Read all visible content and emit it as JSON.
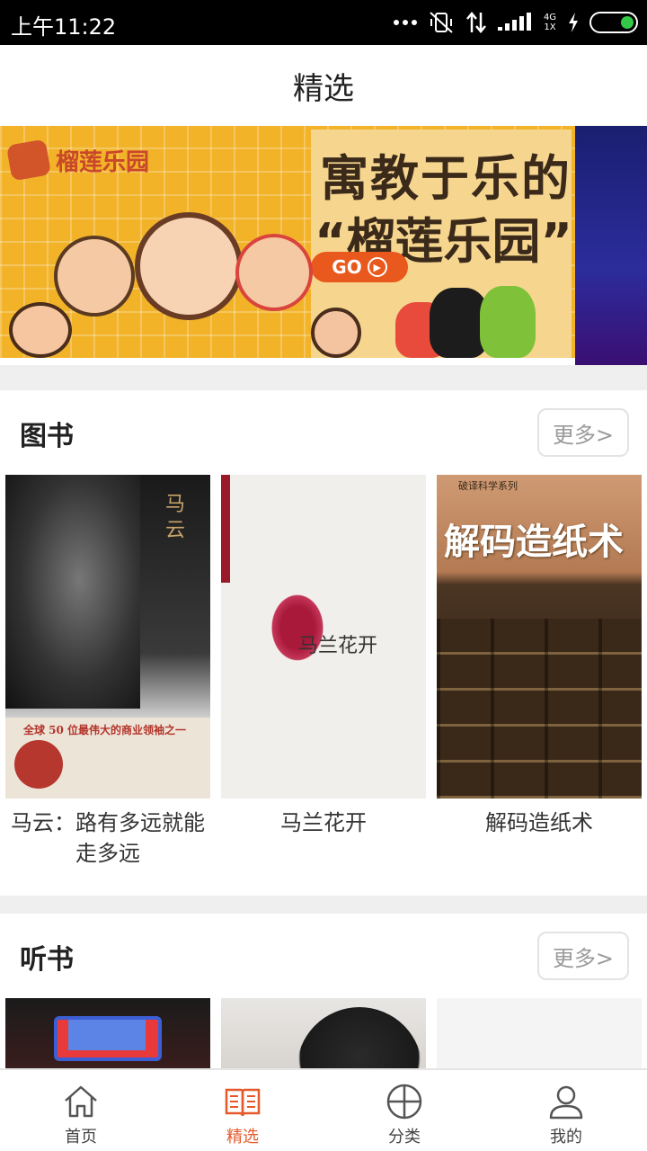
{
  "status_bar": {
    "time": "上午11:22",
    "network_label": "4G 1X"
  },
  "header": {
    "title": "精选"
  },
  "banner": {
    "logo_text": "榴莲乐园",
    "slogan_line1": "寓教于乐的",
    "slogan_line2": "“榴莲乐园”",
    "go_label": "GO"
  },
  "books_section": {
    "title": "图书",
    "more_label": "更多>",
    "items": [
      {
        "title": "马云：路有多远就能走多远",
        "cover_text": "马 云",
        "cover_tag": "全球 50 位最伟大的商业领袖之一"
      },
      {
        "title": "马兰花开",
        "cover_text": "马兰花开"
      },
      {
        "title": "解码造纸术",
        "cover_series": "破译科学系列",
        "cover_text": "解码造纸术"
      }
    ]
  },
  "audio_section": {
    "title": "听书",
    "more_label": "更多>"
  },
  "tabbar": {
    "tabs": [
      {
        "label": "首页",
        "icon": "home-icon",
        "active": false
      },
      {
        "label": "精选",
        "icon": "book-open-icon",
        "active": true
      },
      {
        "label": "分类",
        "icon": "grid-icon",
        "active": false
      },
      {
        "label": "我的",
        "icon": "user-icon",
        "active": false
      }
    ]
  },
  "colors": {
    "accent": "#e5592a",
    "banner_bg": "#f2b329",
    "divider": "#efefef",
    "status_bar_bg": "#000000"
  }
}
